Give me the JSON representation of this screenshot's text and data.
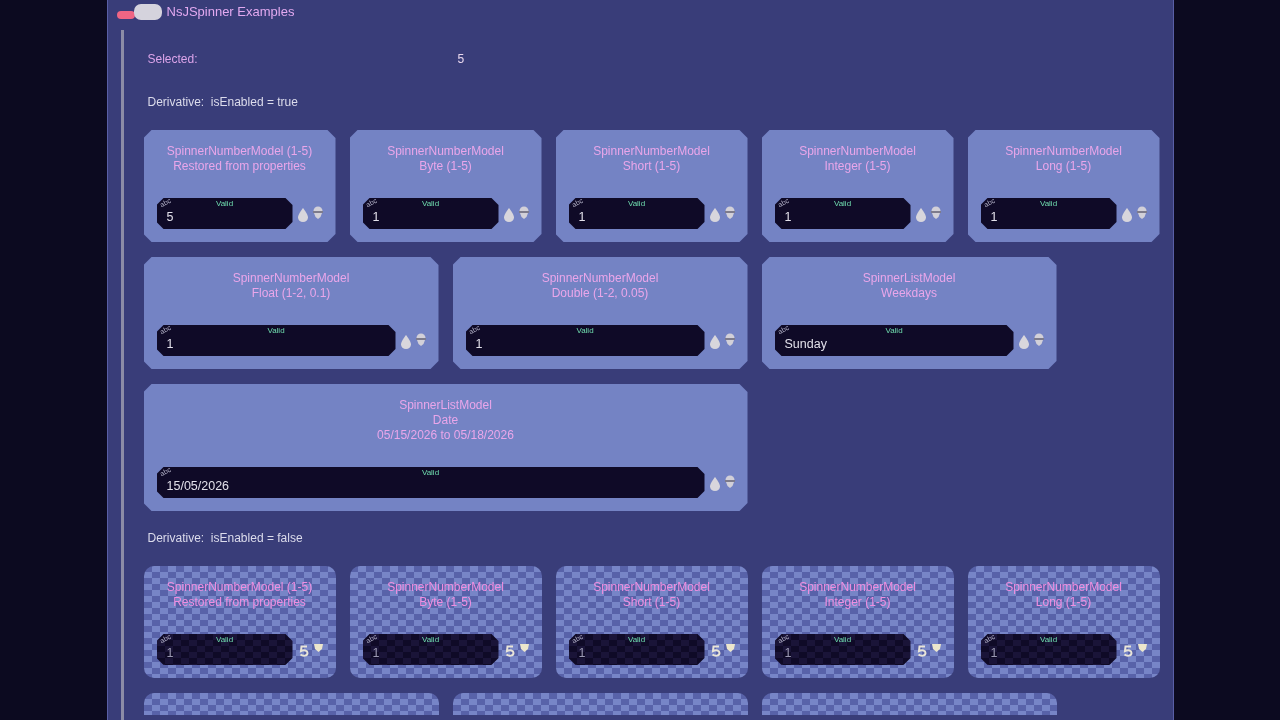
{
  "window": {
    "title": "NsJSpinner Examples"
  },
  "selected": {
    "label": "Selected:",
    "value": "5"
  },
  "sections": [
    {
      "heading": "Derivative:  isEnabled = true",
      "enabled": true,
      "cards": [
        {
          "kind": "small",
          "title": [
            "SpinnerNumberModel (1-5)",
            "Restored from properties"
          ],
          "field": {
            "tag": "abc",
            "status": "Valid",
            "value": "5"
          }
        },
        {
          "kind": "small",
          "title": [
            "SpinnerNumberModel",
            "Byte (1-5)"
          ],
          "field": {
            "tag": "abc",
            "status": "Valid",
            "value": "1"
          }
        },
        {
          "kind": "small",
          "title": [
            "SpinnerNumberModel",
            "Short (1-5)"
          ],
          "field": {
            "tag": "abc",
            "status": "Valid",
            "value": "1"
          }
        },
        {
          "kind": "small",
          "title": [
            "SpinnerNumberModel",
            "Integer (1-5)"
          ],
          "field": {
            "tag": "abc",
            "status": "Valid",
            "value": "1"
          }
        },
        {
          "kind": "small",
          "title": [
            "SpinnerNumberModel",
            "Long (1-5)"
          ],
          "field": {
            "tag": "abc",
            "status": "Valid",
            "value": "1"
          }
        },
        {
          "kind": "medium",
          "title": [
            "SpinnerNumberModel",
            "Float (1-2, 0.1)"
          ],
          "field": {
            "tag": "abc",
            "status": "Valid",
            "value": "1"
          }
        },
        {
          "kind": "medium",
          "title": [
            "SpinnerNumberModel",
            "Double (1-2, 0.05)"
          ],
          "field": {
            "tag": "abc",
            "status": "Valid",
            "value": "1"
          }
        },
        {
          "kind": "medium",
          "title": [
            "SpinnerListModel",
            "Weekdays"
          ],
          "field": {
            "tag": "abc",
            "status": "Valid",
            "value": "Sunday"
          }
        },
        {
          "kind": "large",
          "title": [
            "SpinnerListModel",
            "Date",
            "05/15/2026 to 05/18/2026"
          ],
          "field": {
            "tag": "abc",
            "status": "Valid",
            "value": "15/05/2026"
          }
        }
      ]
    },
    {
      "heading": "Derivative:  isEnabled = false",
      "enabled": false,
      "cards": [
        {
          "kind": "small",
          "title": [
            "SpinnerNumberModel (1-5)",
            "Restored from properties"
          ],
          "field": {
            "tag": "abc",
            "status": "Valid",
            "value": "1"
          }
        },
        {
          "kind": "small",
          "title": [
            "SpinnerNumberModel",
            "Byte (1-5)"
          ],
          "field": {
            "tag": "abc",
            "status": "Valid",
            "value": "1"
          }
        },
        {
          "kind": "small",
          "title": [
            "SpinnerNumberModel",
            "Short (1-5)"
          ],
          "field": {
            "tag": "abc",
            "status": "Valid",
            "value": "1"
          }
        },
        {
          "kind": "small",
          "title": [
            "SpinnerNumberModel",
            "Integer (1-5)"
          ],
          "field": {
            "tag": "abc",
            "status": "Valid",
            "value": "1"
          }
        },
        {
          "kind": "small",
          "title": [
            "SpinnerNumberModel",
            "Long (1-5)"
          ],
          "field": {
            "tag": "abc",
            "status": "Valid",
            "value": "1"
          }
        }
      ],
      "cut_off_cards": [
        {
          "kind": "medium"
        },
        {
          "kind": "medium"
        },
        {
          "kind": "medium"
        }
      ]
    }
  ]
}
